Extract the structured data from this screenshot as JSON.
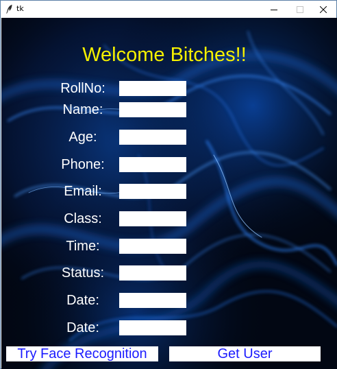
{
  "window": {
    "title": "tk",
    "icon": "feather-icon",
    "controls": [
      "minimize-icon",
      "maximize-icon",
      "close-icon"
    ]
  },
  "heading": "Welcome Bitches!!",
  "colors": {
    "heading": "#f5f000",
    "label": "#ffffff",
    "button_text": "#1a1aff",
    "background": "#020713",
    "glow": "#1e78ff"
  },
  "form": {
    "fields": [
      {
        "label": "RollNo:",
        "value": ""
      },
      {
        "label": "Name:",
        "value": ""
      },
      {
        "label": "Age:",
        "value": ""
      },
      {
        "label": "Phone:",
        "value": ""
      },
      {
        "label": "Email:",
        "value": ""
      },
      {
        "label": "Class:",
        "value": ""
      },
      {
        "label": "Time:",
        "value": ""
      },
      {
        "label": "Status:",
        "value": ""
      },
      {
        "label": "Date:",
        "value": ""
      },
      {
        "label": "Date:",
        "value": ""
      }
    ]
  },
  "buttons": {
    "face_recognition": "Try Face Recognition",
    "get_user": "Get User"
  }
}
